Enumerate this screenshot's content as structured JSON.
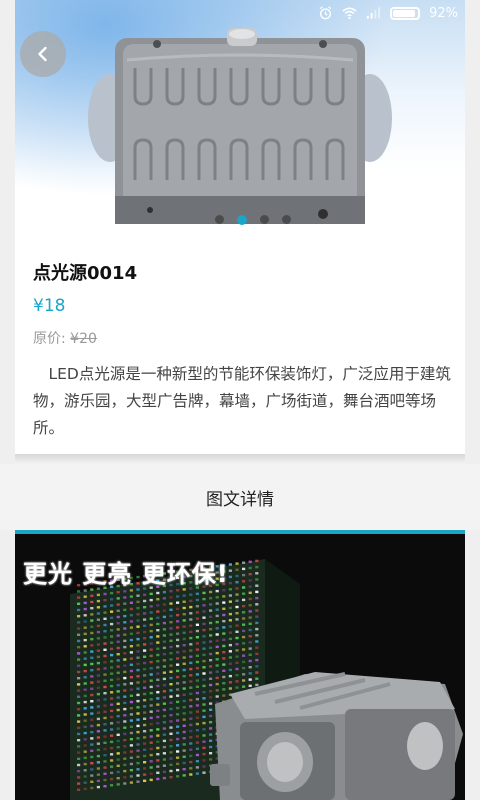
{
  "status_bar": {
    "battery_percent": "92%",
    "icons": [
      "alarm-icon",
      "wifi-icon",
      "signal-icon",
      "battery-icon"
    ],
    "text_color": "#ffffff"
  },
  "hero": {
    "carousel_total": 4,
    "carousel_active_index": 1,
    "accent_color": "#19a6c9"
  },
  "product": {
    "name": "点光源0014",
    "price": "¥18",
    "original_label": "原价:",
    "original_price": "¥20",
    "description": "LED点光源是一种新型的节能环保装饰灯，广泛应用于建筑物，游乐园，大型广告牌，幕墙，广场街道，舞台酒吧等场所。"
  },
  "section": {
    "title": "图文详情",
    "accent_color": "#1ba5c5"
  },
  "detail_image": {
    "slogan": "更光 更亮 更环保!"
  }
}
